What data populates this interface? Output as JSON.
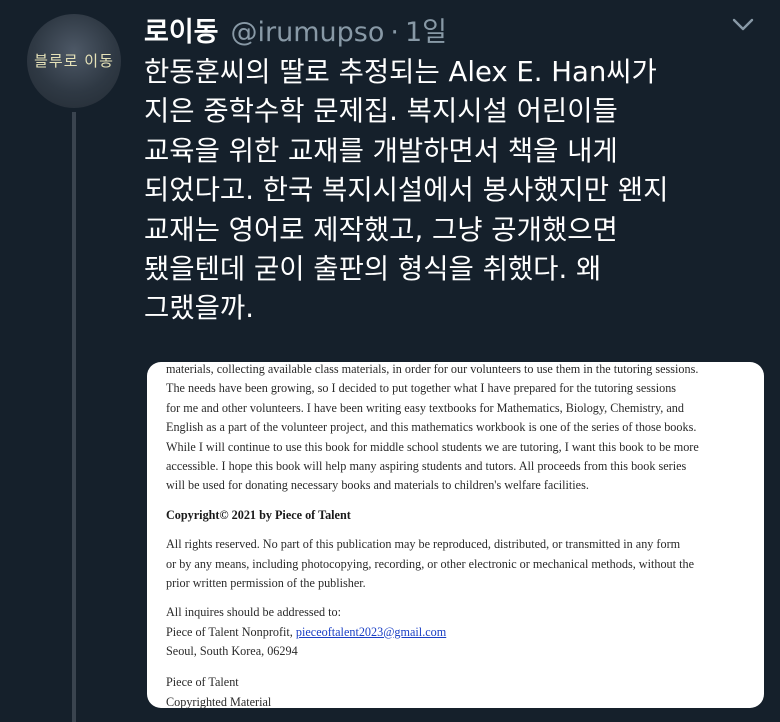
{
  "user": {
    "display_name": "로이동",
    "handle": "@irumupso",
    "separator": "·",
    "time": "1일",
    "avatar_text": "블루로 이동"
  },
  "tweet": {
    "lines": [
      "한동훈씨의 딸로 추정되는 Alex E. Han씨가",
      "지은 중학수학 문제집. 복지시설 어린이들",
      "교육을 위한 교재를 개발하면서 책을 내게",
      "되었다고. 한국 복지시설에서 봉사했지만 왠지",
      "교재는 영어로 제작했고, 그냥 공개했으면",
      "됐을텐데 굳이 출판의 형식을 취했다. 왜",
      "그랬을까."
    ]
  },
  "media": {
    "paragraph": [
      "materials, collecting available class materials, in order for our volunteers to use them in the tutoring sessions.",
      "The needs have been growing, so I decided to put together what I have prepared for the tutoring sessions",
      "for me and other volunteers. I have been writing easy textbooks for Mathematics, Biology, Chemistry, and",
      "English as a part of the volunteer project, and this mathematics workbook is one of the series of those books.",
      "While I will continue to use this book for middle school students we are tutoring, I want this book to be more",
      "accessible.  I hope this book will help many aspiring students and tutors. All proceeds from this book series",
      "will be used for donating necessary books and materials to children's welfare facilities."
    ],
    "copyright": "Copyright© 2021 by Piece of Talent",
    "rights": [
      "All rights reserved. No part of this publication may be reproduced, distributed, or transmitted in any form",
      "or by any means, including photocopying, recording, or other electronic or mechanical methods, without the",
      "prior written permission of the publisher."
    ],
    "inquiries_label": "All inquires should be addressed to:",
    "org_name": "Piece of Talent Nonprofit, ",
    "email": "pieceoftalent2023@gmail.com",
    "address": "Seoul, South Korea, 06294",
    "footer_name": "Piece of Talent",
    "footer_note": "Copyrighted Material"
  }
}
